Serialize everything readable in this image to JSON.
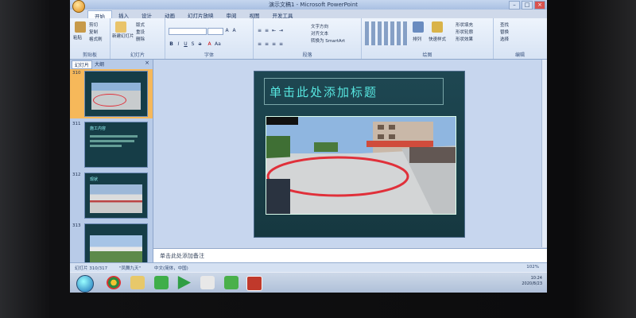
{
  "window": {
    "title": "演示文稿1 - Microsoft PowerPoint",
    "controls": [
      "–",
      "□",
      "×"
    ]
  },
  "ribbon": {
    "tabs": [
      "开始",
      "插入",
      "设计",
      "动画",
      "幻灯片放映",
      "审阅",
      "视图",
      "开发工具"
    ],
    "active_tab": "开始",
    "clipboard": {
      "paste": "粘贴",
      "cut": "剪切",
      "copy": "复制",
      "format_painter": "格式刷",
      "label": "剪贴板"
    },
    "slides": {
      "new_slide": "新建幻灯片",
      "layout": "版式",
      "reset": "重设",
      "delete": "删除",
      "label": "幻灯片"
    },
    "font": {
      "label": "字体"
    },
    "paragraph": {
      "text_direction": "文字方向",
      "align_text": "对齐文本",
      "smartart": "转换为 SmartArt",
      "label": "段落"
    },
    "drawing": {
      "arrange": "排列",
      "quick_styles": "快速样式",
      "shape_fill": "形状填充",
      "shape_outline": "形状轮廓",
      "shape_effects": "形状效果",
      "label": "绘图"
    },
    "editing": {
      "find": "查找",
      "replace": "替换",
      "select": "选择",
      "label": "编辑"
    }
  },
  "panel": {
    "tabs": [
      "幻灯片",
      "大纲"
    ],
    "close": "×",
    "thumbnails": [
      {
        "num": "310",
        "title": ""
      },
      {
        "num": "311",
        "title": "施工内容"
      },
      {
        "num": "312",
        "title": "现状"
      },
      {
        "num": "313",
        "title": ""
      }
    ]
  },
  "slide": {
    "title": "单击此处添加标题"
  },
  "notes": {
    "placeholder": "单击此处添加备注"
  },
  "status": {
    "slide_count": "幻灯片 310/317",
    "theme": "\"凤舞九天\"",
    "language": "中文(简体，中国)",
    "zoom": "102%"
  },
  "tray": {
    "time": "10:24",
    "date": "2020/8/23"
  },
  "colors": {
    "slide_bg": "#1e4752",
    "title_text": "#57e6e0",
    "annotation": "#e0303a"
  }
}
